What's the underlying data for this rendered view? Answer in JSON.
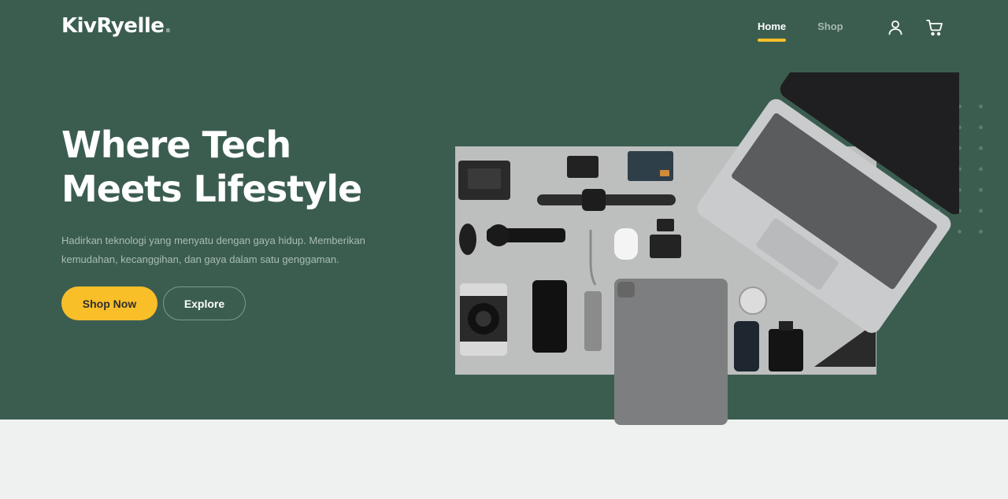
{
  "brand": {
    "name": "KivRyelle",
    "dot": "."
  },
  "nav": {
    "items": [
      {
        "label": "Home",
        "active": true
      },
      {
        "label": "Shop",
        "active": false
      }
    ],
    "icons": [
      "user-icon",
      "cart-icon"
    ]
  },
  "hero": {
    "title_line1": "Where Tech",
    "title_line2": "Meets Lifestyle",
    "description": "Hadirkan teknologi yang menyatu dengan gaya hidup. Memberikan kemudahan, kecanggihan, dan gaya dalam satu genggaman.",
    "primary_button": "Shop Now",
    "secondary_button": "Explore",
    "image": "product-flatlay"
  },
  "colors": {
    "hero_bg": "#3b5d50",
    "accent": "#f9bf29",
    "page_bg": "#eff1f0"
  }
}
